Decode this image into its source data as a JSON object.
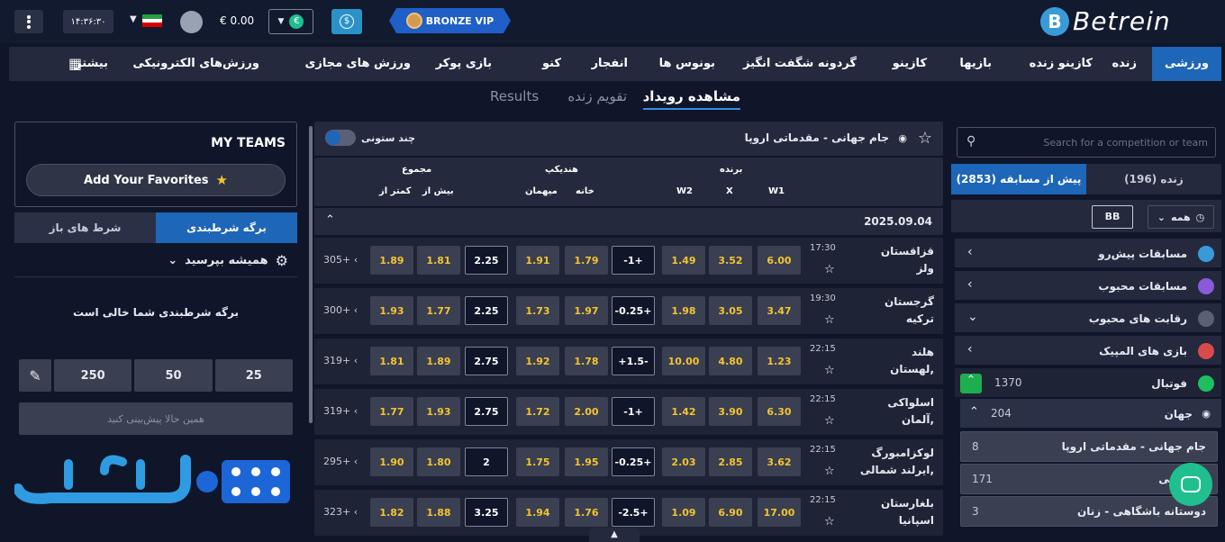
{
  "header": {
    "clock": "۱۴:۳۶:۳۰",
    "balance": "€ 0.00",
    "currency_icon": "€",
    "dollar_icon": "$",
    "vip": "BRONZE VIP",
    "logo_letter": "B",
    "logo_text": "Betrein"
  },
  "nav": [
    "ورزشی",
    "زنده",
    "کازینو زنده",
    "بازیها",
    "کازینو",
    "گردونه شگفت انگیز",
    "بونوس ها",
    "انفجار",
    "کنو",
    "بازی پوکر",
    "ورزش های مجازی",
    "ورزش‌های الکترونیکی",
    "بیشتر"
  ],
  "subtabs": [
    "مشاهده رویداد",
    "تقویم زنده",
    "Results"
  ],
  "left": {
    "my_teams": "MY TEAMS",
    "add_fav": "Add Your Favorites",
    "tab_betslip": "برگه شرطبندی",
    "tab_open": "شرط های باز",
    "always_ask": "همیشه بپرسید",
    "empty": "برگه شرطبندی شما خالی است",
    "stakes": [
      "250",
      "50",
      "25"
    ],
    "predict": "همین حالا پیش‌بینی کنید"
  },
  "center": {
    "title": "جام جهانی - مقدماتی اروپا",
    "multi_col": "چند ستونی",
    "hdr_winner": "برنده",
    "hdr_handicap": "هندیکپ",
    "hdr_total": "مجموع",
    "w1": "W1",
    "x": "X",
    "w2": "W2",
    "home": "خانه",
    "away": "میهمان",
    "over": "بیش از",
    "under": "کمتر از",
    "date": "2025.09.04",
    "matches": [
      {
        "t1": "قزاقستان",
        "t2": "ولز",
        "time": "17:30",
        "w1": "6.00",
        "x": "3.52",
        "w2": "1.49",
        "hc": "-1+",
        "h": "1.79",
        "a": "1.91",
        "tl": "2.25",
        "o": "1.81",
        "u": "1.89",
        "more": "305+"
      },
      {
        "t1": "گرجستان",
        "t2": "ترکیه",
        "time": "19:30",
        "w1": "3.47",
        "x": "3.05",
        "w2": "1.98",
        "hc": "-0.25+",
        "h": "1.97",
        "a": "1.73",
        "tl": "2.25",
        "o": "1.77",
        "u": "1.93",
        "more": "300+"
      },
      {
        "t1": "هلند",
        "t2": "لهستان,",
        "time": "22:15",
        "w1": "1.23",
        "x": "4.80",
        "w2": "10.00",
        "hc": "+1.5-",
        "h": "1.78",
        "a": "1.92",
        "tl": "2.75",
        "o": "1.89",
        "u": "1.81",
        "more": "319+"
      },
      {
        "t1": "اسلواکی",
        "t2": "آلمان,",
        "time": "22:15",
        "w1": "6.30",
        "x": "3.90",
        "w2": "1.42",
        "hc": "-1+",
        "h": "2.00",
        "a": "1.72",
        "tl": "2.75",
        "o": "1.93",
        "u": "1.77",
        "more": "319+"
      },
      {
        "t1": "لوکزامبورگ",
        "t2": "ایرلند شمالی,",
        "time": "22:15",
        "w1": "3.62",
        "x": "2.85",
        "w2": "2.03",
        "hc": "-0.25+",
        "h": "1.95",
        "a": "1.75",
        "tl": "2",
        "o": "1.80",
        "u": "1.90",
        "more": "295+"
      },
      {
        "t1": "بلغارستان",
        "t2": "اسپانیا",
        "time": "22:15",
        "w1": "17.00",
        "x": "6.90",
        "w2": "1.09",
        "hc": "-2.5+",
        "h": "1.76",
        "a": "1.94",
        "tl": "3.25",
        "o": "1.88",
        "u": "1.82",
        "more": "323+"
      }
    ]
  },
  "right": {
    "search_ph": "Search for a competition or team",
    "tab_pre": "پیش از مسابقه (2853)",
    "tab_live": "زنده (196)",
    "filter_all": "همه",
    "filter_code": "BB",
    "items": [
      "مسابقات پیش‌رو",
      "مسابقات محبوب",
      "رقابت های محبوب",
      "بازی های المپیک"
    ],
    "football": "فوتبال",
    "football_count": "1370",
    "world": "جهان",
    "world_count": "204",
    "subs": [
      {
        "name": "جام جهانی - مقدماتی اروپا",
        "count": "8"
      },
      {
        "name": "باشگاهی",
        "count": "171"
      },
      {
        "name": "دوستانه باشگاهی - زنان",
        "count": "3"
      }
    ]
  }
}
